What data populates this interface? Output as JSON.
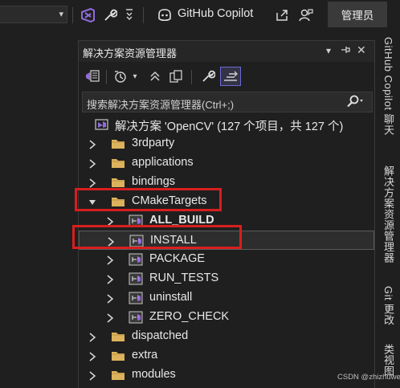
{
  "toolbar": {
    "copilot_label": "GitHub Copilot",
    "admin_button": "管理员"
  },
  "solution_explorer": {
    "title": "解决方案资源管理器",
    "search_placeholder": "搜索解决方案资源管理器(Ctrl+;)",
    "solution_label": "解决方案 'OpenCV' (127 个项目，共 127 个)",
    "tree": [
      {
        "label": "3rdparty",
        "kind": "folder",
        "expanded": false
      },
      {
        "label": "applications",
        "kind": "folder",
        "expanded": false
      },
      {
        "label": "bindings",
        "kind": "folder",
        "expanded": false
      },
      {
        "label": "CMakeTargets",
        "kind": "folder",
        "expanded": true
      },
      {
        "label": "ALL_BUILD",
        "kind": "project",
        "expanded": false,
        "bold": true
      },
      {
        "label": "INSTALL",
        "kind": "project",
        "expanded": false,
        "selected": true
      },
      {
        "label": "PACKAGE",
        "kind": "project",
        "expanded": false
      },
      {
        "label": "RUN_TESTS",
        "kind": "project",
        "expanded": false
      },
      {
        "label": "uninstall",
        "kind": "project",
        "expanded": false
      },
      {
        "label": "ZERO_CHECK",
        "kind": "project",
        "expanded": false
      },
      {
        "label": "dispatched",
        "kind": "folder",
        "expanded": false
      },
      {
        "label": "extra",
        "kind": "folder",
        "expanded": false
      },
      {
        "label": "modules",
        "kind": "folder",
        "expanded": false
      }
    ]
  },
  "side_tabs": {
    "copilot_chat": "GitHub Copilot 聊天",
    "solution_explorer": "解决方案资源管理器",
    "git_changes": "Git 更改",
    "class_view": "类视图"
  },
  "watermark": "CSDN @zhizhuwei",
  "colors": {
    "background": "#1f1f1f",
    "highlight_red": "#d81e1e",
    "folder": "#dcb35c",
    "vs_purple": "#8f6bd8"
  }
}
